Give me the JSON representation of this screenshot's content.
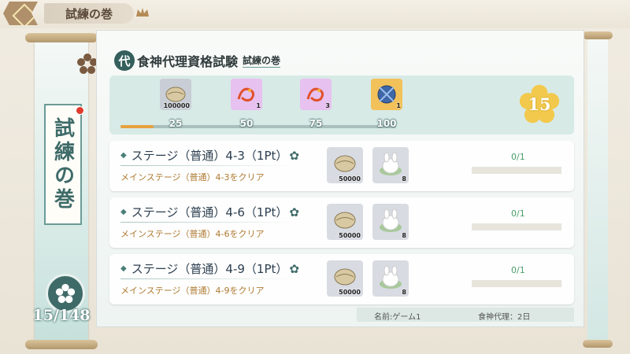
{
  "header": {
    "title": "試練の巻"
  },
  "left_scroll": {
    "vertical_title": "試練の巻",
    "count": "15/148"
  },
  "panel": {
    "header_title": "食神代理資格試験",
    "header_subtitle": "試練の巻",
    "header_icon_char": "代"
  },
  "rewards": {
    "progress": 0.12,
    "star_level": "15",
    "milestones": [
      {
        "label": "25",
        "qty": "100000",
        "icon": "shell-icon",
        "bg": "#c9ced6"
      },
      {
        "label": "50",
        "qty": "1",
        "icon": "fire-dragon-icon",
        "bg": "#e7c1ef"
      },
      {
        "label": "75",
        "qty": "3",
        "icon": "fire-dragon-icon",
        "bg": "#e7c1ef"
      },
      {
        "label": "100",
        "qty": "1",
        "icon": "blue-crystal-icon",
        "bg": "#f2c15a"
      }
    ]
  },
  "stages": [
    {
      "title": "ステージ（普通）4-3（1Pt）",
      "desc": "メインステージ（普通）4-3をクリア",
      "progress_text": "0/1",
      "progress": 0,
      "items": [
        {
          "icon": "shell-icon",
          "qty": "50000"
        },
        {
          "icon": "rabbit-bun-icon",
          "qty": "8"
        }
      ]
    },
    {
      "title": "ステージ（普通）4-6（1Pt）",
      "desc": "メインステージ（普通）4-6をクリア",
      "progress_text": "0/1",
      "progress": 0,
      "items": [
        {
          "icon": "shell-icon",
          "qty": "50000"
        },
        {
          "icon": "rabbit-bun-icon",
          "qty": "8"
        }
      ]
    },
    {
      "title": "ステージ（普通）4-9（1Pt）",
      "desc": "メインステージ（普通）4-9をクリア",
      "progress_text": "0/1",
      "progress": 0,
      "items": [
        {
          "icon": "shell-icon",
          "qty": "50000"
        },
        {
          "icon": "rabbit-bun-icon",
          "qty": "8"
        }
      ]
    }
  ],
  "footer": {
    "name": "名前:ゲーム1",
    "agent": "食神代理：2日"
  },
  "colors": {
    "accent": "#3e6b68",
    "progress": "#e6a23c",
    "desc": "#b07a33"
  }
}
